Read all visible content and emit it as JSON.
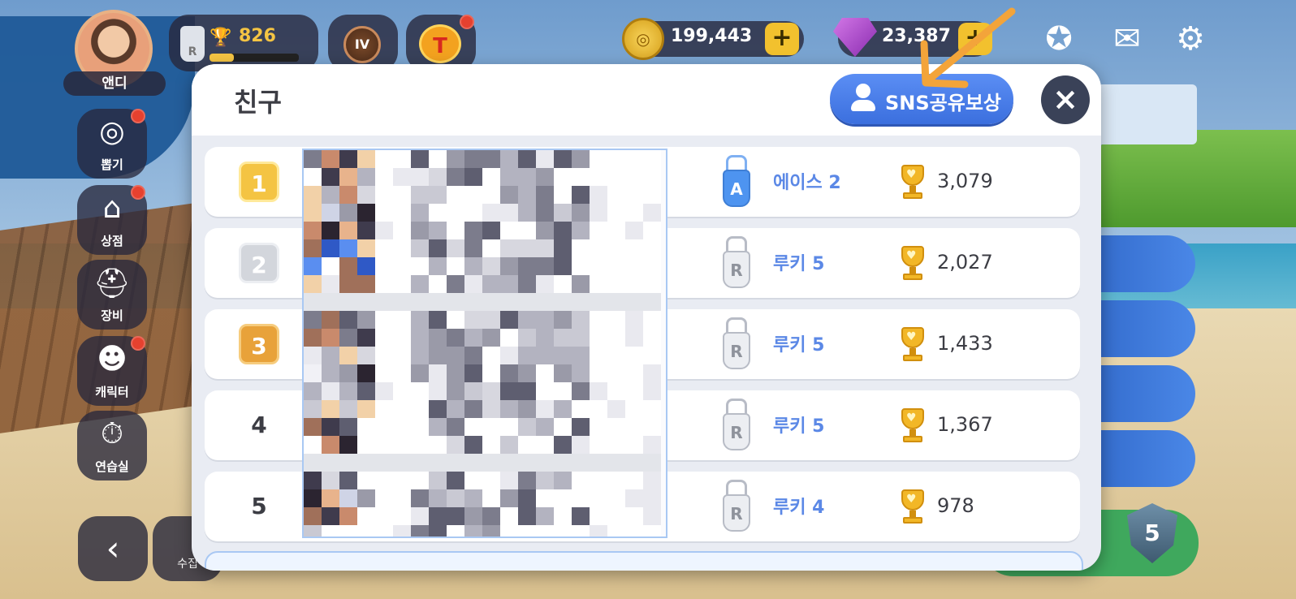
{
  "player": {
    "name": "앤디",
    "trophies": "826"
  },
  "rank_medal": "IV",
  "ticket_icon": "T",
  "currency": {
    "coins": "199,443",
    "gems": "23,387"
  },
  "left_menu": [
    {
      "label": "뽑기",
      "icon": "gacha-icon"
    },
    {
      "label": "상점",
      "icon": "shop-icon"
    },
    {
      "label": "장비",
      "icon": "equipment-icon"
    },
    {
      "label": "캐릭터",
      "icon": "character-icon"
    },
    {
      "label": "연습실",
      "icon": "practice-icon"
    }
  ],
  "bottom_tabs": {
    "collect": "수집"
  },
  "league_level": "5",
  "modal": {
    "title": "친구",
    "sns_button": "SNS공유보상",
    "close": "×"
  },
  "friends": [
    {
      "rank": "1",
      "bag": "A",
      "tier": "에이스 2",
      "trophies": "3,079"
    },
    {
      "rank": "2",
      "bag": "R",
      "tier": "루키 5",
      "trophies": "2,027"
    },
    {
      "rank": "3",
      "bag": "R",
      "tier": "루키 5",
      "trophies": "1,433"
    },
    {
      "rank": "4",
      "bag": "R",
      "tier": "루키 5",
      "trophies": "1,367"
    },
    {
      "rank": "5",
      "bag": "R",
      "tier": "루키 4",
      "trophies": "978"
    }
  ],
  "colors": {
    "gold": "#f4c443",
    "silver": "#d3d6dc",
    "bronze": "#e8a23a",
    "tier_blue": "#5b88e6",
    "sns_blue": "#4a7fe8",
    "annotation_arrow": "#f3a43a"
  }
}
